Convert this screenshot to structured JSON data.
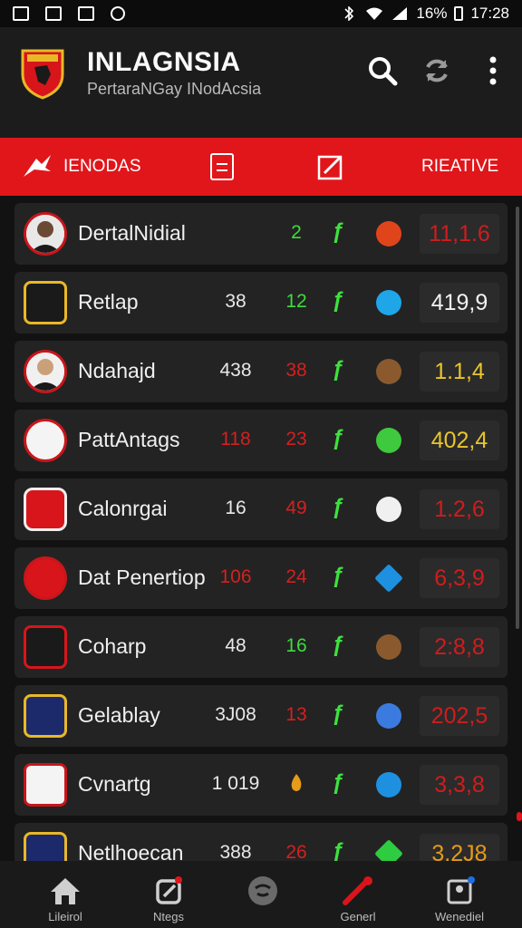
{
  "status_bar": {
    "battery": "16%",
    "time": "17:28"
  },
  "header": {
    "title": "INLAGNSIA",
    "subtitle": "PertaraNGay INodAcsia"
  },
  "filter_bar": {
    "left_label": "IENODAS",
    "right_label": "RIEATIVE"
  },
  "rows": [
    {
      "name": "DertalNidial",
      "col1": "",
      "col2": "2",
      "score": "11,1.6",
      "col1_color": "#e8e8e8",
      "col2_color": "#3ddc3d",
      "score_color": "#cf1d1d",
      "badge_color": "#e0441b"
    },
    {
      "name": "Retlap",
      "col1": "38",
      "col2": "12",
      "score": "419,9",
      "col1_color": "#e8e8e8",
      "col2_color": "#3ddc3d",
      "score_color": "#f2f2f2",
      "badge_color": "#1ea6e8"
    },
    {
      "name": "Ndahajd",
      "col1": "438",
      "col2": "38",
      "score": "1.1,4",
      "col1_color": "#e8e8e8",
      "col2_color": "#d42020",
      "score_color": "#e9c62a",
      "badge_color": "#8a5a2e"
    },
    {
      "name": "PattAntags",
      "col1": "118",
      "col2": "23",
      "score": "402,4",
      "col1_color": "#d42020",
      "col2_color": "#d42020",
      "score_color": "#e9c62a",
      "badge_color": "#3ec93e"
    },
    {
      "name": "Calonrgai",
      "col1": "16",
      "col2": "49",
      "score": "1.2,6",
      "col1_color": "#e8e8e8",
      "col2_color": "#d42020",
      "score_color": "#cf1d1d",
      "badge_color": "#f0f0f0"
    },
    {
      "name": "Dat Penertiop",
      "col1": "106",
      "col2": "24",
      "score": "6,3,9",
      "col1_color": "#d42020",
      "col2_color": "#d42020",
      "score_color": "#cf1d1d",
      "badge_color": "#1e90e0"
    },
    {
      "name": "Coharp",
      "col1": "48",
      "col2": "16",
      "score": "2:8,8",
      "col1_color": "#e8e8e8",
      "col2_color": "#3ddc3d",
      "score_color": "#cf1d1d",
      "badge_color": "#8a5a2e"
    },
    {
      "name": "Gelablay",
      "col1": "3J08",
      "col2": "13",
      "score": "202,5",
      "col1_color": "#e8e8e8",
      "col2_color": "#d42020",
      "score_color": "#cf1d1d",
      "badge_color": "#3b7be0"
    },
    {
      "name": "Cvnartg",
      "col1": "1 019",
      "col2": "",
      "score": "3,3,8",
      "col1_color": "#e8e8e8",
      "col2_color": "#e69b1a",
      "score_color": "#cf1d1d",
      "badge_color": "#1e90e0"
    },
    {
      "name": "Netlhoecan",
      "col1": "388",
      "col2": "26",
      "score": "3.2J8",
      "col1_color": "#e8e8e8",
      "col2_color": "#d42020",
      "score_color": "#e69b1a",
      "badge_color": "#2ecc40"
    }
  ],
  "nav": [
    {
      "label": "Lileirol",
      "icon": "home-icon"
    },
    {
      "label": "Ntegs",
      "icon": "edit-icon"
    },
    {
      "label": "",
      "icon": "chat-icon"
    },
    {
      "label": "Generl",
      "icon": "tool-icon"
    },
    {
      "label": "Wenediel",
      "icon": "profile-icon"
    }
  ]
}
